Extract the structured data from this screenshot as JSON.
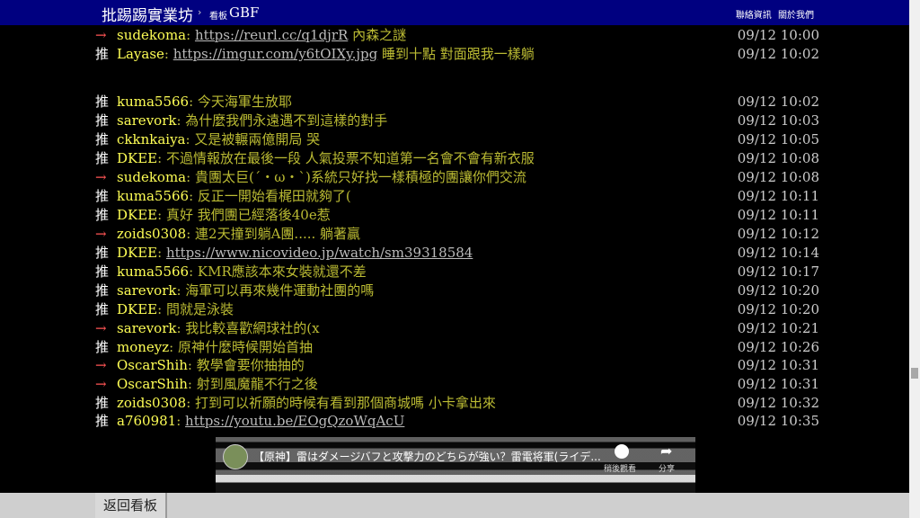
{
  "header": {
    "site_title": "批踢踢實業坊",
    "crumb_sep": "›",
    "crumb_label": "看板",
    "board": "GBF",
    "links": [
      "聯絡資訊",
      "關於我們"
    ]
  },
  "comments": [
    {
      "tag": "→",
      "kind": "arrow",
      "user": "sudekoma",
      "link": "https://reurl.cc/q1djrR",
      "text": " 內森之謎",
      "time": "09/12 10:00"
    },
    {
      "tag": "推",
      "kind": "push",
      "user": "Layase",
      "link": "https://imgur.com/y6tOIXy.jpg",
      "text": " 睡到十點 對面跟我一樣躺",
      "time": "09/12 10:02"
    },
    {
      "tag": "推",
      "kind": "push",
      "user": "kuma5566",
      "text": "今天海軍生放耶",
      "time": "09/12 10:02"
    },
    {
      "tag": "推",
      "kind": "push",
      "user": "sarevork",
      "text": "為什麼我們永遠遇不到這樣的對手",
      "time": "09/12 10:03"
    },
    {
      "tag": "推",
      "kind": "push",
      "user": "ckknkaiya",
      "text": "又是被輾兩億開局 哭",
      "time": "09/12 10:05"
    },
    {
      "tag": "推",
      "kind": "push",
      "user": "DKEE",
      "text": "不過情報放在最後一段 人氣投票不知道第一名會不會有新衣服",
      "time": "09/12 10:08"
    },
    {
      "tag": "→",
      "kind": "arrow",
      "user": "sudekoma",
      "text": "貴團太巨(´・ω・`)系統只好找一樣積極的團讓你們交流",
      "time": "09/12 10:08"
    },
    {
      "tag": "推",
      "kind": "push",
      "user": "kuma5566",
      "text": "反正一開始看梶田就夠了(",
      "time": "09/12 10:11"
    },
    {
      "tag": "推",
      "kind": "push",
      "user": "DKEE",
      "text": "真好 我們團已經落後40e惹",
      "time": "09/12 10:11"
    },
    {
      "tag": "→",
      "kind": "arrow",
      "user": "zoids0308",
      "text": "連2天撞到躺A團..... 躺著贏",
      "time": "09/12 10:12"
    },
    {
      "tag": "推",
      "kind": "push",
      "user": "DKEE",
      "link": "https://www.nicovideo.jp/watch/sm39318584",
      "text": "",
      "time": "09/12 10:14"
    },
    {
      "tag": "推",
      "kind": "push",
      "user": "kuma5566",
      "text": "KMR應該本來女裝就還不差",
      "time": "09/12 10:17"
    },
    {
      "tag": "推",
      "kind": "push",
      "user": "sarevork",
      "text": "海軍可以再來幾件運動社團的嗎",
      "time": "09/12 10:20"
    },
    {
      "tag": "推",
      "kind": "push",
      "user": "DKEE",
      "text": "問就是泳裝",
      "time": "09/12 10:20"
    },
    {
      "tag": "→",
      "kind": "arrow",
      "user": "sarevork",
      "text": "我比較喜歡網球社的(x",
      "time": "09/12 10:21"
    },
    {
      "tag": "推",
      "kind": "push",
      "user": "moneyz",
      "text": "原神什麼時候開始首抽",
      "time": "09/12 10:26"
    },
    {
      "tag": "→",
      "kind": "arrow",
      "user": "OscarShih",
      "text": "教學會要你抽抽的",
      "time": "09/12 10:31"
    },
    {
      "tag": "→",
      "kind": "arrow",
      "user": "OscarShih",
      "text": "射到風魔龍不行之後",
      "time": "09/12 10:31"
    },
    {
      "tag": "推",
      "kind": "push",
      "user": "zoids0308",
      "text": "打到可以祈願的時候有看到那個商城嗎 小卡拿出來",
      "time": "09/12 10:32"
    },
    {
      "tag": "推",
      "kind": "push",
      "user": "a760981",
      "link": "https://youtu.be/EOgQzoWqAcU",
      "text": "",
      "time": "09/12 10:35"
    }
  ],
  "video": {
    "title": "【原神】雷はダメージバフと攻撃力のどちらが強い？雷電将軍(ライデ...",
    "watch_later": "稍後觀看",
    "share": "分享"
  },
  "footer": {
    "back_label": "返回看板"
  }
}
